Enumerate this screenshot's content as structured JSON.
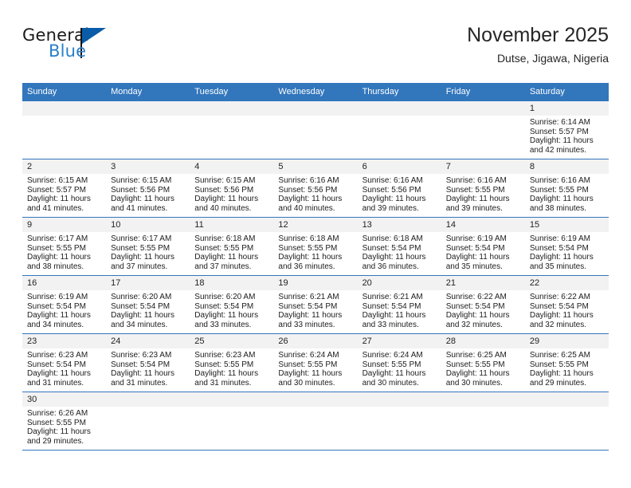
{
  "brand": {
    "name_top": "General",
    "name_bottom": "Blue",
    "logo_icon": "triangle-flag-icon",
    "accent_color": "#2a7fc9",
    "flag_color": "#0a5ca8"
  },
  "header": {
    "month_title": "November 2025",
    "location": "Dutse, Jigawa, Nigeria"
  },
  "calendar": {
    "header_bg": "#3276bc",
    "daynum_bg": "#f2f2f2",
    "weekday_headers": [
      "Sunday",
      "Monday",
      "Tuesday",
      "Wednesday",
      "Thursday",
      "Friday",
      "Saturday"
    ],
    "weeks": [
      [
        {
          "day": "",
          "empty": true,
          "sunrise": "",
          "sunset": "",
          "daylight_line1": "",
          "daylight_line2": ""
        },
        {
          "day": "",
          "empty": true,
          "sunrise": "",
          "sunset": "",
          "daylight_line1": "",
          "daylight_line2": ""
        },
        {
          "day": "",
          "empty": true,
          "sunrise": "",
          "sunset": "",
          "daylight_line1": "",
          "daylight_line2": ""
        },
        {
          "day": "",
          "empty": true,
          "sunrise": "",
          "sunset": "",
          "daylight_line1": "",
          "daylight_line2": ""
        },
        {
          "day": "",
          "empty": true,
          "sunrise": "",
          "sunset": "",
          "daylight_line1": "",
          "daylight_line2": ""
        },
        {
          "day": "",
          "empty": true,
          "sunrise": "",
          "sunset": "",
          "daylight_line1": "",
          "daylight_line2": ""
        },
        {
          "day": "1",
          "empty": false,
          "sunrise": "Sunrise: 6:14 AM",
          "sunset": "Sunset: 5:57 PM",
          "daylight_line1": "Daylight: 11 hours",
          "daylight_line2": "and 42 minutes."
        }
      ],
      [
        {
          "day": "2",
          "empty": false,
          "sunrise": "Sunrise: 6:15 AM",
          "sunset": "Sunset: 5:57 PM",
          "daylight_line1": "Daylight: 11 hours",
          "daylight_line2": "and 41 minutes."
        },
        {
          "day": "3",
          "empty": false,
          "sunrise": "Sunrise: 6:15 AM",
          "sunset": "Sunset: 5:56 PM",
          "daylight_line1": "Daylight: 11 hours",
          "daylight_line2": "and 41 minutes."
        },
        {
          "day": "4",
          "empty": false,
          "sunrise": "Sunrise: 6:15 AM",
          "sunset": "Sunset: 5:56 PM",
          "daylight_line1": "Daylight: 11 hours",
          "daylight_line2": "and 40 minutes."
        },
        {
          "day": "5",
          "empty": false,
          "sunrise": "Sunrise: 6:16 AM",
          "sunset": "Sunset: 5:56 PM",
          "daylight_line1": "Daylight: 11 hours",
          "daylight_line2": "and 40 minutes."
        },
        {
          "day": "6",
          "empty": false,
          "sunrise": "Sunrise: 6:16 AM",
          "sunset": "Sunset: 5:56 PM",
          "daylight_line1": "Daylight: 11 hours",
          "daylight_line2": "and 39 minutes."
        },
        {
          "day": "7",
          "empty": false,
          "sunrise": "Sunrise: 6:16 AM",
          "sunset": "Sunset: 5:55 PM",
          "daylight_line1": "Daylight: 11 hours",
          "daylight_line2": "and 39 minutes."
        },
        {
          "day": "8",
          "empty": false,
          "sunrise": "Sunrise: 6:16 AM",
          "sunset": "Sunset: 5:55 PM",
          "daylight_line1": "Daylight: 11 hours",
          "daylight_line2": "and 38 minutes."
        }
      ],
      [
        {
          "day": "9",
          "empty": false,
          "sunrise": "Sunrise: 6:17 AM",
          "sunset": "Sunset: 5:55 PM",
          "daylight_line1": "Daylight: 11 hours",
          "daylight_line2": "and 38 minutes."
        },
        {
          "day": "10",
          "empty": false,
          "sunrise": "Sunrise: 6:17 AM",
          "sunset": "Sunset: 5:55 PM",
          "daylight_line1": "Daylight: 11 hours",
          "daylight_line2": "and 37 minutes."
        },
        {
          "day": "11",
          "empty": false,
          "sunrise": "Sunrise: 6:18 AM",
          "sunset": "Sunset: 5:55 PM",
          "daylight_line1": "Daylight: 11 hours",
          "daylight_line2": "and 37 minutes."
        },
        {
          "day": "12",
          "empty": false,
          "sunrise": "Sunrise: 6:18 AM",
          "sunset": "Sunset: 5:55 PM",
          "daylight_line1": "Daylight: 11 hours",
          "daylight_line2": "and 36 minutes."
        },
        {
          "day": "13",
          "empty": false,
          "sunrise": "Sunrise: 6:18 AM",
          "sunset": "Sunset: 5:54 PM",
          "daylight_line1": "Daylight: 11 hours",
          "daylight_line2": "and 36 minutes."
        },
        {
          "day": "14",
          "empty": false,
          "sunrise": "Sunrise: 6:19 AM",
          "sunset": "Sunset: 5:54 PM",
          "daylight_line1": "Daylight: 11 hours",
          "daylight_line2": "and 35 minutes."
        },
        {
          "day": "15",
          "empty": false,
          "sunrise": "Sunrise: 6:19 AM",
          "sunset": "Sunset: 5:54 PM",
          "daylight_line1": "Daylight: 11 hours",
          "daylight_line2": "and 35 minutes."
        }
      ],
      [
        {
          "day": "16",
          "empty": false,
          "sunrise": "Sunrise: 6:19 AM",
          "sunset": "Sunset: 5:54 PM",
          "daylight_line1": "Daylight: 11 hours",
          "daylight_line2": "and 34 minutes."
        },
        {
          "day": "17",
          "empty": false,
          "sunrise": "Sunrise: 6:20 AM",
          "sunset": "Sunset: 5:54 PM",
          "daylight_line1": "Daylight: 11 hours",
          "daylight_line2": "and 34 minutes."
        },
        {
          "day": "18",
          "empty": false,
          "sunrise": "Sunrise: 6:20 AM",
          "sunset": "Sunset: 5:54 PM",
          "daylight_line1": "Daylight: 11 hours",
          "daylight_line2": "and 33 minutes."
        },
        {
          "day": "19",
          "empty": false,
          "sunrise": "Sunrise: 6:21 AM",
          "sunset": "Sunset: 5:54 PM",
          "daylight_line1": "Daylight: 11 hours",
          "daylight_line2": "and 33 minutes."
        },
        {
          "day": "20",
          "empty": false,
          "sunrise": "Sunrise: 6:21 AM",
          "sunset": "Sunset: 5:54 PM",
          "daylight_line1": "Daylight: 11 hours",
          "daylight_line2": "and 33 minutes."
        },
        {
          "day": "21",
          "empty": false,
          "sunrise": "Sunrise: 6:22 AM",
          "sunset": "Sunset: 5:54 PM",
          "daylight_line1": "Daylight: 11 hours",
          "daylight_line2": "and 32 minutes."
        },
        {
          "day": "22",
          "empty": false,
          "sunrise": "Sunrise: 6:22 AM",
          "sunset": "Sunset: 5:54 PM",
          "daylight_line1": "Daylight: 11 hours",
          "daylight_line2": "and 32 minutes."
        }
      ],
      [
        {
          "day": "23",
          "empty": false,
          "sunrise": "Sunrise: 6:23 AM",
          "sunset": "Sunset: 5:54 PM",
          "daylight_line1": "Daylight: 11 hours",
          "daylight_line2": "and 31 minutes."
        },
        {
          "day": "24",
          "empty": false,
          "sunrise": "Sunrise: 6:23 AM",
          "sunset": "Sunset: 5:54 PM",
          "daylight_line1": "Daylight: 11 hours",
          "daylight_line2": "and 31 minutes."
        },
        {
          "day": "25",
          "empty": false,
          "sunrise": "Sunrise: 6:23 AM",
          "sunset": "Sunset: 5:55 PM",
          "daylight_line1": "Daylight: 11 hours",
          "daylight_line2": "and 31 minutes."
        },
        {
          "day": "26",
          "empty": false,
          "sunrise": "Sunrise: 6:24 AM",
          "sunset": "Sunset: 5:55 PM",
          "daylight_line1": "Daylight: 11 hours",
          "daylight_line2": "and 30 minutes."
        },
        {
          "day": "27",
          "empty": false,
          "sunrise": "Sunrise: 6:24 AM",
          "sunset": "Sunset: 5:55 PM",
          "daylight_line1": "Daylight: 11 hours",
          "daylight_line2": "and 30 minutes."
        },
        {
          "day": "28",
          "empty": false,
          "sunrise": "Sunrise: 6:25 AM",
          "sunset": "Sunset: 5:55 PM",
          "daylight_line1": "Daylight: 11 hours",
          "daylight_line2": "and 30 minutes."
        },
        {
          "day": "29",
          "empty": false,
          "sunrise": "Sunrise: 6:25 AM",
          "sunset": "Sunset: 5:55 PM",
          "daylight_line1": "Daylight: 11 hours",
          "daylight_line2": "and 29 minutes."
        }
      ],
      [
        {
          "day": "30",
          "empty": false,
          "sunrise": "Sunrise: 6:26 AM",
          "sunset": "Sunset: 5:55 PM",
          "daylight_line1": "Daylight: 11 hours",
          "daylight_line2": "and 29 minutes."
        },
        {
          "day": "",
          "empty": true,
          "sunrise": "",
          "sunset": "",
          "daylight_line1": "",
          "daylight_line2": ""
        },
        {
          "day": "",
          "empty": true,
          "sunrise": "",
          "sunset": "",
          "daylight_line1": "",
          "daylight_line2": ""
        },
        {
          "day": "",
          "empty": true,
          "sunrise": "",
          "sunset": "",
          "daylight_line1": "",
          "daylight_line2": ""
        },
        {
          "day": "",
          "empty": true,
          "sunrise": "",
          "sunset": "",
          "daylight_line1": "",
          "daylight_line2": ""
        },
        {
          "day": "",
          "empty": true,
          "sunrise": "",
          "sunset": "",
          "daylight_line1": "",
          "daylight_line2": ""
        },
        {
          "day": "",
          "empty": true,
          "sunrise": "",
          "sunset": "",
          "daylight_line1": "",
          "daylight_line2": ""
        }
      ]
    ]
  }
}
